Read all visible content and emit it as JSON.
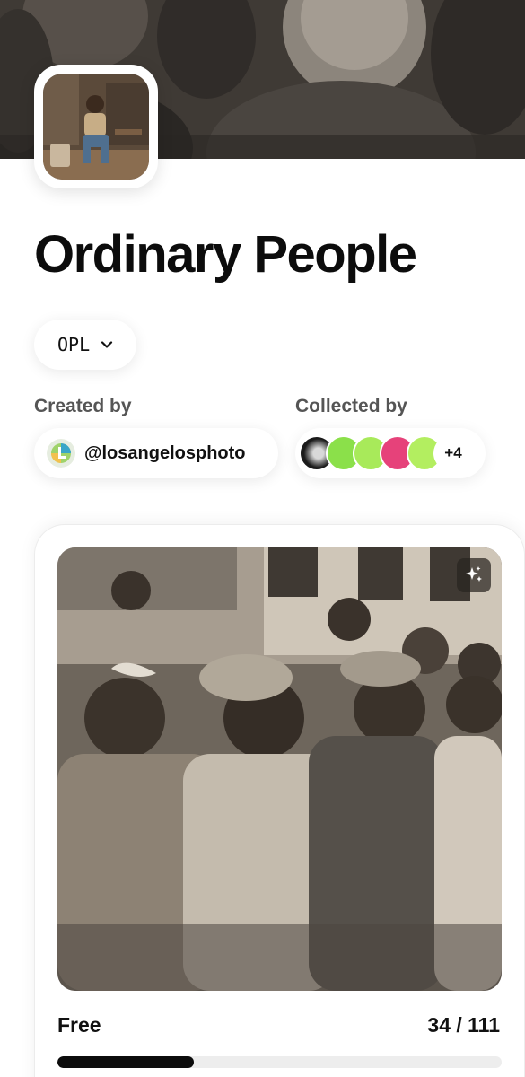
{
  "collection": {
    "title": "Ordinary People",
    "ticker": "OPL"
  },
  "creator": {
    "label": "Created by",
    "handle": "@losangelosphoto"
  },
  "collectors": {
    "label": "Collected by",
    "extra_count": "+4",
    "avatar_colors": [
      "#1a1a1a",
      "#8be04a",
      "#a8ea5a",
      "#e6427a",
      "#b3ee60"
    ]
  },
  "edition": {
    "price": "Free",
    "minted_text": "34 / 111",
    "minted": 34,
    "supply": 111
  },
  "icons": {
    "ticker_dropdown": "chevron-down-icon",
    "artwork_action": "sparkles-icon"
  }
}
